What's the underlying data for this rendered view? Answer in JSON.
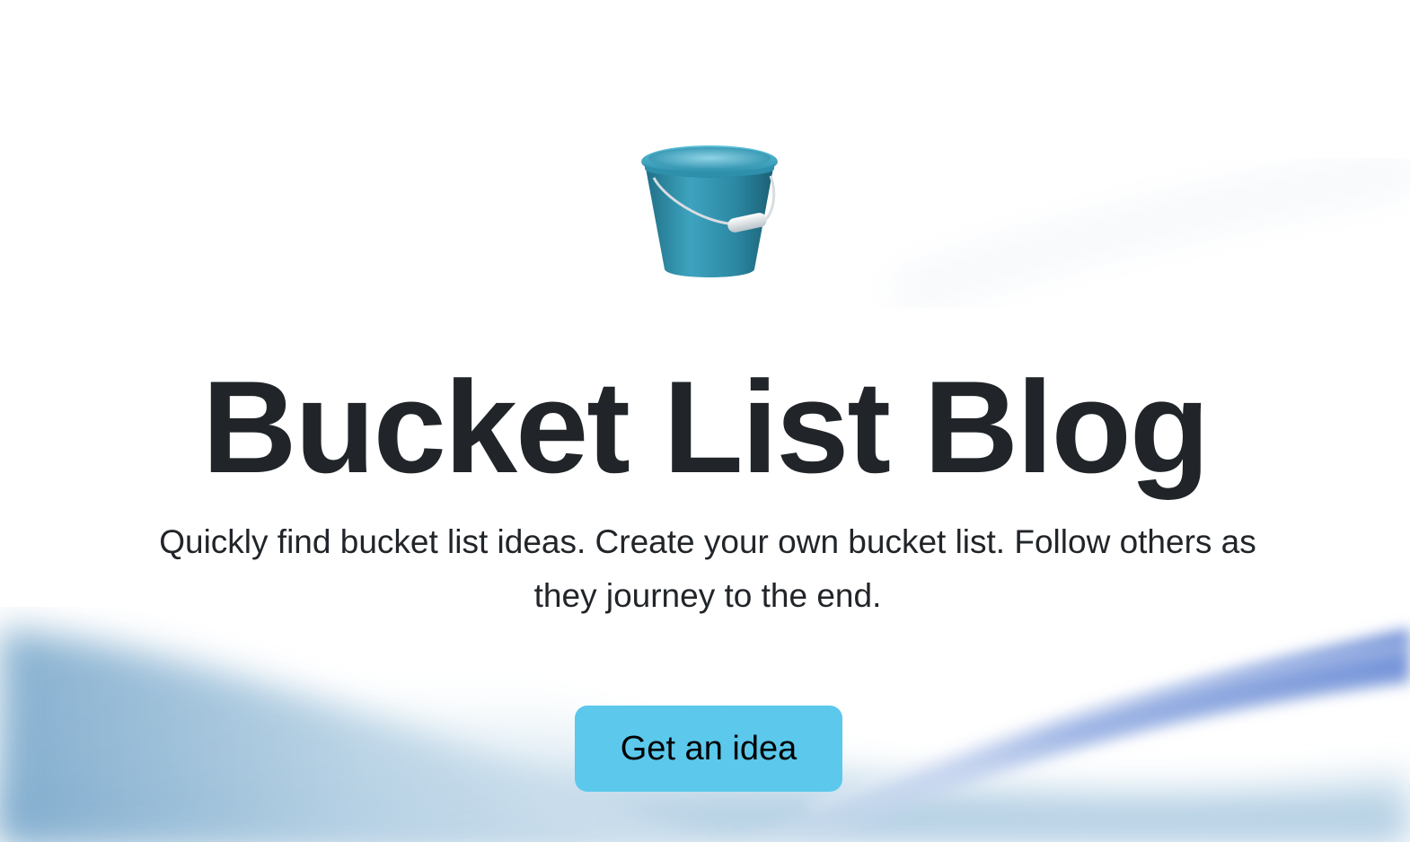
{
  "hero": {
    "title": "Bucket List Blog",
    "lead": "Quickly find bucket list ideas. Create your own bucket list. Follow others as they journey to the end.",
    "cta_label": "Get an idea",
    "icon": "bucket-icon"
  },
  "colors": {
    "background": "#ffffff",
    "text": "#212529",
    "cta_background": "#5bc8ec",
    "cta_text": "#000000",
    "wave_light_blue": "#a9c9e0",
    "wave_dark_blue": "#6f8fd4"
  }
}
